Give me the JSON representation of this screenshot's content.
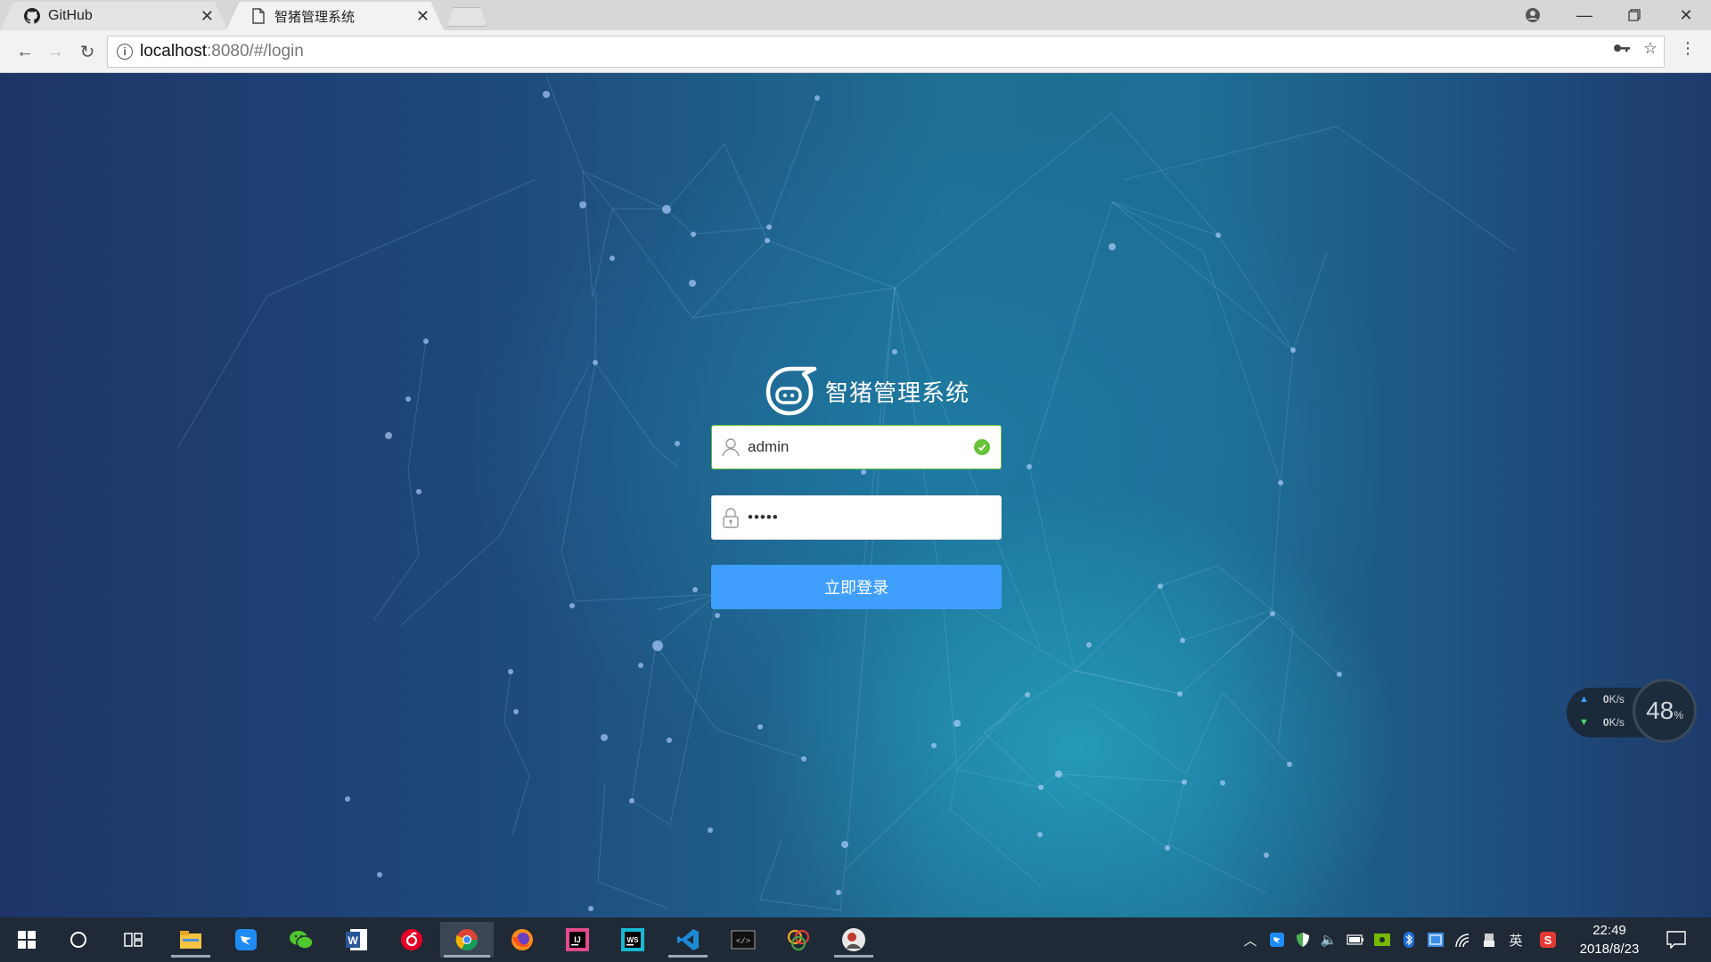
{
  "browser": {
    "tabs": [
      {
        "title": "GitHub",
        "icon": "github-icon",
        "active": false
      },
      {
        "title": "智猪管理系统",
        "icon": "page-icon",
        "active": true
      }
    ],
    "url_host": "localhost",
    "url_path": ":8080/#/login"
  },
  "login": {
    "title": "智猪管理系统",
    "username_value": "admin",
    "password_value": "•••••",
    "submit_label": "立即登录"
  },
  "net_monitor": {
    "upload": "0",
    "download": "0",
    "unit": "K/s",
    "percent": "48",
    "percent_sign": "%"
  },
  "taskbar": {
    "apps": [
      "start",
      "cortana",
      "task-view",
      "file-explorer",
      "dingtalk",
      "wechat",
      "word",
      "netease-music",
      "chrome",
      "firefox",
      "intellij",
      "webstorm",
      "vscode",
      "terminal",
      "photo-app",
      "avatar-app"
    ],
    "tray_lang": "英",
    "time": "22:49",
    "date": "2018/8/23"
  },
  "colors": {
    "primary_button": "#409eff",
    "valid_green": "#67c23a",
    "taskbar_bg": "#1f2a36"
  }
}
